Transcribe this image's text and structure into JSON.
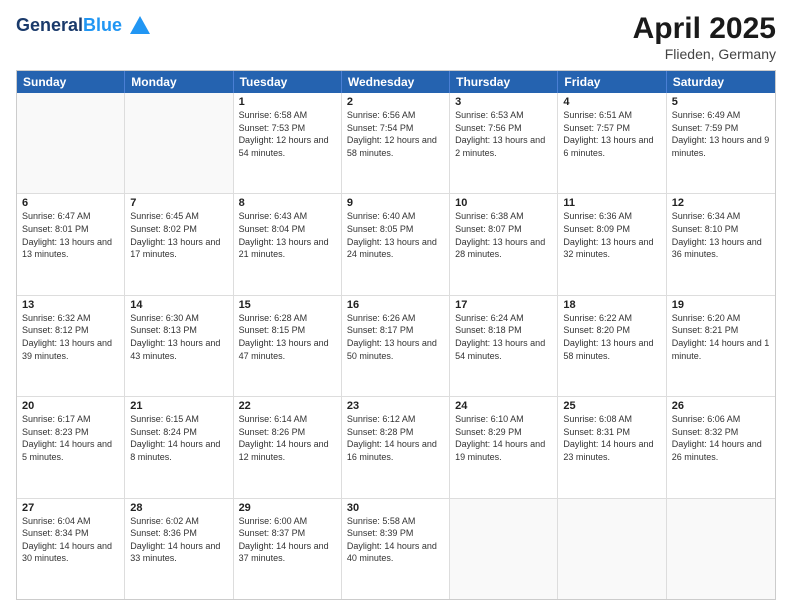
{
  "header": {
    "logo_line1": "General",
    "logo_line2": "Blue",
    "main_title": "April 2025",
    "subtitle": "Flieden, Germany"
  },
  "days_of_week": [
    "Sunday",
    "Monday",
    "Tuesday",
    "Wednesday",
    "Thursday",
    "Friday",
    "Saturday"
  ],
  "weeks": [
    [
      {
        "day": "",
        "info": ""
      },
      {
        "day": "",
        "info": ""
      },
      {
        "day": "1",
        "info": "Sunrise: 6:58 AM\nSunset: 7:53 PM\nDaylight: 12 hours and 54 minutes."
      },
      {
        "day": "2",
        "info": "Sunrise: 6:56 AM\nSunset: 7:54 PM\nDaylight: 12 hours and 58 minutes."
      },
      {
        "day": "3",
        "info": "Sunrise: 6:53 AM\nSunset: 7:56 PM\nDaylight: 13 hours and 2 minutes."
      },
      {
        "day": "4",
        "info": "Sunrise: 6:51 AM\nSunset: 7:57 PM\nDaylight: 13 hours and 6 minutes."
      },
      {
        "day": "5",
        "info": "Sunrise: 6:49 AM\nSunset: 7:59 PM\nDaylight: 13 hours and 9 minutes."
      }
    ],
    [
      {
        "day": "6",
        "info": "Sunrise: 6:47 AM\nSunset: 8:01 PM\nDaylight: 13 hours and 13 minutes."
      },
      {
        "day": "7",
        "info": "Sunrise: 6:45 AM\nSunset: 8:02 PM\nDaylight: 13 hours and 17 minutes."
      },
      {
        "day": "8",
        "info": "Sunrise: 6:43 AM\nSunset: 8:04 PM\nDaylight: 13 hours and 21 minutes."
      },
      {
        "day": "9",
        "info": "Sunrise: 6:40 AM\nSunset: 8:05 PM\nDaylight: 13 hours and 24 minutes."
      },
      {
        "day": "10",
        "info": "Sunrise: 6:38 AM\nSunset: 8:07 PM\nDaylight: 13 hours and 28 minutes."
      },
      {
        "day": "11",
        "info": "Sunrise: 6:36 AM\nSunset: 8:09 PM\nDaylight: 13 hours and 32 minutes."
      },
      {
        "day": "12",
        "info": "Sunrise: 6:34 AM\nSunset: 8:10 PM\nDaylight: 13 hours and 36 minutes."
      }
    ],
    [
      {
        "day": "13",
        "info": "Sunrise: 6:32 AM\nSunset: 8:12 PM\nDaylight: 13 hours and 39 minutes."
      },
      {
        "day": "14",
        "info": "Sunrise: 6:30 AM\nSunset: 8:13 PM\nDaylight: 13 hours and 43 minutes."
      },
      {
        "day": "15",
        "info": "Sunrise: 6:28 AM\nSunset: 8:15 PM\nDaylight: 13 hours and 47 minutes."
      },
      {
        "day": "16",
        "info": "Sunrise: 6:26 AM\nSunset: 8:17 PM\nDaylight: 13 hours and 50 minutes."
      },
      {
        "day": "17",
        "info": "Sunrise: 6:24 AM\nSunset: 8:18 PM\nDaylight: 13 hours and 54 minutes."
      },
      {
        "day": "18",
        "info": "Sunrise: 6:22 AM\nSunset: 8:20 PM\nDaylight: 13 hours and 58 minutes."
      },
      {
        "day": "19",
        "info": "Sunrise: 6:20 AM\nSunset: 8:21 PM\nDaylight: 14 hours and 1 minute."
      }
    ],
    [
      {
        "day": "20",
        "info": "Sunrise: 6:17 AM\nSunset: 8:23 PM\nDaylight: 14 hours and 5 minutes."
      },
      {
        "day": "21",
        "info": "Sunrise: 6:15 AM\nSunset: 8:24 PM\nDaylight: 14 hours and 8 minutes."
      },
      {
        "day": "22",
        "info": "Sunrise: 6:14 AM\nSunset: 8:26 PM\nDaylight: 14 hours and 12 minutes."
      },
      {
        "day": "23",
        "info": "Sunrise: 6:12 AM\nSunset: 8:28 PM\nDaylight: 14 hours and 16 minutes."
      },
      {
        "day": "24",
        "info": "Sunrise: 6:10 AM\nSunset: 8:29 PM\nDaylight: 14 hours and 19 minutes."
      },
      {
        "day": "25",
        "info": "Sunrise: 6:08 AM\nSunset: 8:31 PM\nDaylight: 14 hours and 23 minutes."
      },
      {
        "day": "26",
        "info": "Sunrise: 6:06 AM\nSunset: 8:32 PM\nDaylight: 14 hours and 26 minutes."
      }
    ],
    [
      {
        "day": "27",
        "info": "Sunrise: 6:04 AM\nSunset: 8:34 PM\nDaylight: 14 hours and 30 minutes."
      },
      {
        "day": "28",
        "info": "Sunrise: 6:02 AM\nSunset: 8:36 PM\nDaylight: 14 hours and 33 minutes."
      },
      {
        "day": "29",
        "info": "Sunrise: 6:00 AM\nSunset: 8:37 PM\nDaylight: 14 hours and 37 minutes."
      },
      {
        "day": "30",
        "info": "Sunrise: 5:58 AM\nSunset: 8:39 PM\nDaylight: 14 hours and 40 minutes."
      },
      {
        "day": "",
        "info": ""
      },
      {
        "day": "",
        "info": ""
      },
      {
        "day": "",
        "info": ""
      }
    ]
  ]
}
